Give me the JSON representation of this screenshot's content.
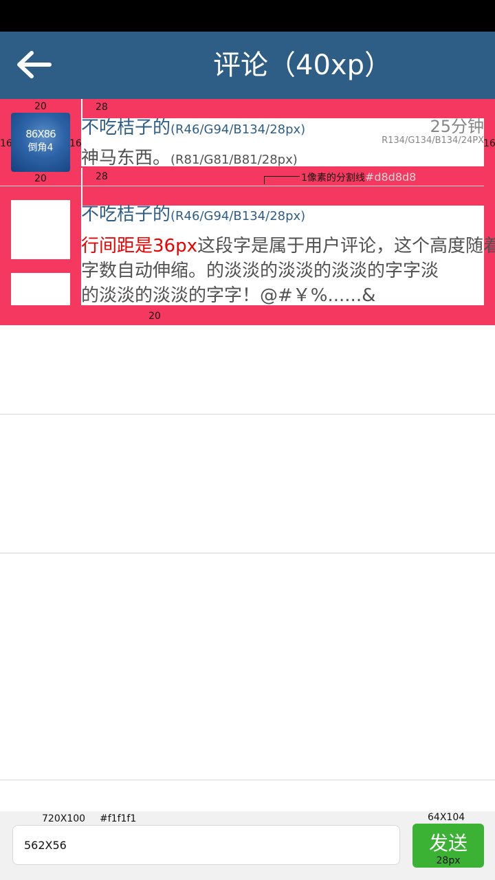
{
  "header": {
    "title": "评论（40xp）",
    "back_icon": "arrow-left-icon"
  },
  "comments": [
    {
      "username": "不吃桔子的",
      "username_spec": "(R46/G94/B134/28px)",
      "text": "神马东西。",
      "text_spec": "(R81/G81/B81/28px)",
      "time": "25分钟",
      "time_spec": "R134/G134/B134/24PX",
      "avatar_label_size": "86X86",
      "avatar_label_radius": "倒角4"
    },
    {
      "username": "不吃桔子的",
      "username_spec": "(R46/G94/B134/28px)",
      "text_highlight": "行间距是36px",
      "text_line1": "这段字是属于用户评论，这个高度随着",
      "text_line2": "字数自动伸缩。的淡淡的淡淡的淡淡的字字淡",
      "text_line3": "的淡淡的淡淡的字字！@#￥%......&"
    }
  ],
  "annotations": {
    "pad_20": "20",
    "pad_28": "28",
    "pad_16": "16",
    "divider_note": "1像素的分割线",
    "divider_hex": "#d8d8d8",
    "bottom_bar_size": "720X100",
    "bottom_bar_color": "#f1f1f1",
    "button_size": "64X104",
    "button_font": "28px"
  },
  "input_bar": {
    "input_value": "562X56",
    "send_label": "发送"
  },
  "colors": {
    "title_bar": "#2e5e86",
    "annotation_bg": "#f4385f",
    "divider": "#d8d8d8",
    "send_button": "#3bb233",
    "bottom_bar": "#f1f1f1"
  }
}
